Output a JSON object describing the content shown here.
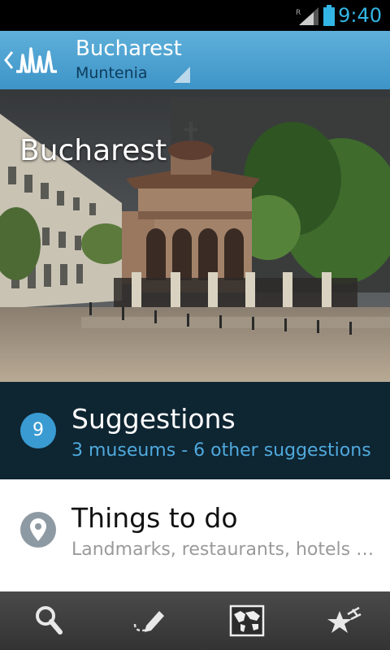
{
  "status": {
    "time": "9:40"
  },
  "header": {
    "title": "Bucharest",
    "subtitle": "Muntenia"
  },
  "hero": {
    "title": "Bucharest"
  },
  "suggestions": {
    "count": "9",
    "title": "Suggestions",
    "subtitle": "3 museums - 6 other suggestions"
  },
  "things_to_do": {
    "title": "Things to do",
    "subtitle": "Landmarks, restaurants, hotels …"
  },
  "bottom_tabs": [
    "search-icon",
    "notes-pencil-icon",
    "world-map-icon",
    "favorites-star-icon"
  ],
  "colors": {
    "accent": "#33b5e5",
    "actionbar": "#4ea3d1",
    "suggestions_bg": "#0e2532",
    "badge": "#3a9bd2"
  }
}
